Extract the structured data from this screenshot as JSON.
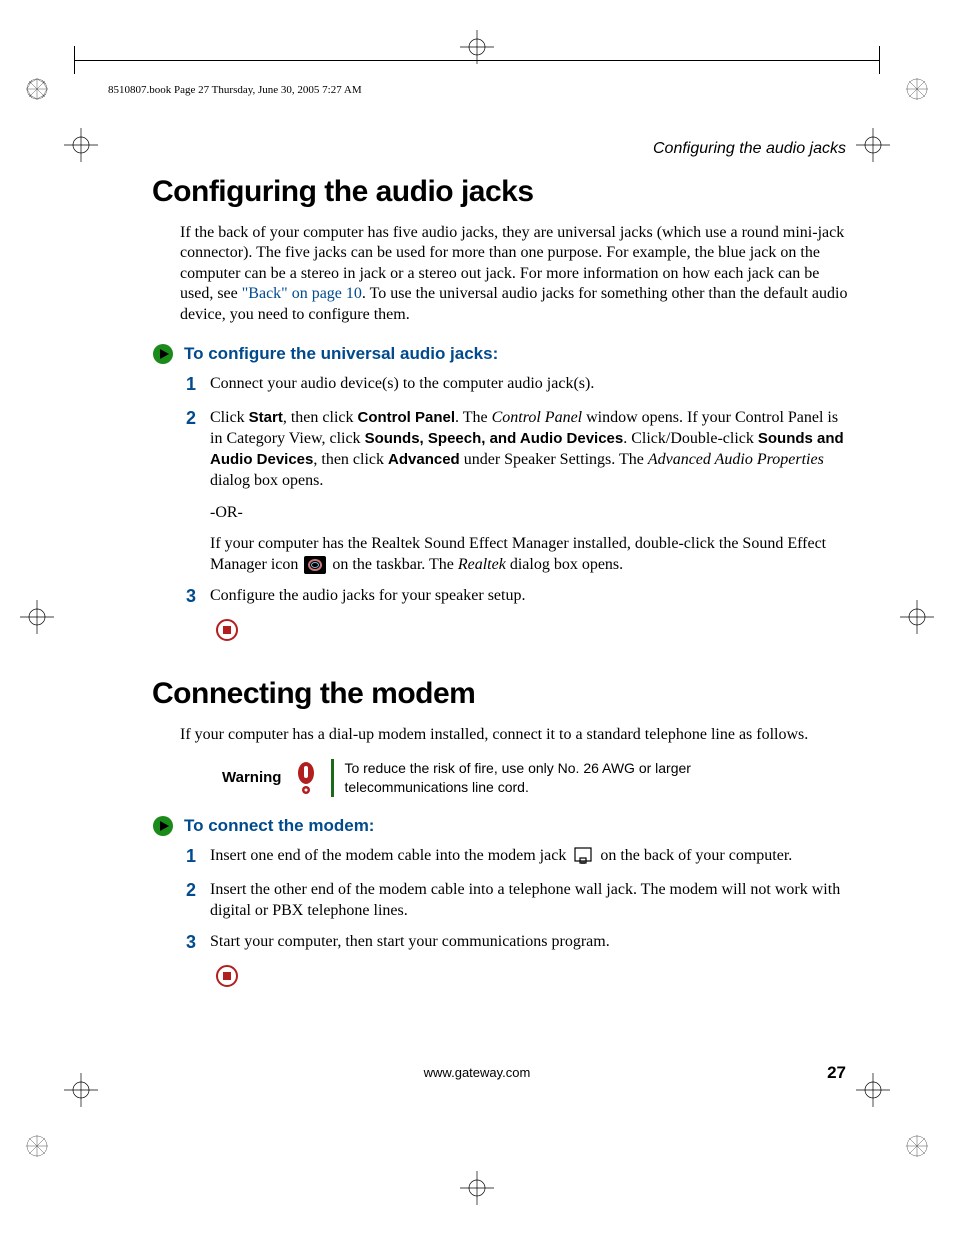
{
  "book_header": "8510807.book  Page 27  Thursday, June 30, 2005  7:27 AM",
  "running_head": "Configuring the audio jacks",
  "section1": {
    "title": "Configuring the audio jacks",
    "intro_pre": "If the back of your computer has five audio jacks, they are universal jacks (which use a round mini-jack connector). The five jacks can be used for more than one purpose. For example, the blue jack on the computer can be a stereo in jack or a stereo out jack. For more information on how each jack can be used, see ",
    "intro_link": "\"Back\" on page 10",
    "intro_post": ". To use the universal audio jacks for something other than the default audio device, you need to configure them.",
    "proc_title": "To configure the universal audio jacks:",
    "steps": {
      "s1": "Connect your audio device(s) to the computer audio jack(s).",
      "s2_a": "Click ",
      "s2_b": "Start",
      "s2_c": ", then click ",
      "s2_d": "Control Panel",
      "s2_e": ". The ",
      "s2_f": "Control Panel",
      "s2_g": " window opens. If your Control Panel is in Category View, click ",
      "s2_h": "Sounds, Speech, and Audio Devices",
      "s2_i": ". Click/Double-click ",
      "s2_j": "Sounds and Audio Devices",
      "s2_k": ", then click ",
      "s2_l": "Advanced",
      "s2_m": " under Speaker Settings. The ",
      "s2_n": "Advanced Audio Properties",
      "s2_o": " dialog box opens.",
      "s2_or": "-OR-",
      "s2_p": "If your computer has the Realtek Sound Effect Manager installed, double-click the Sound Effect Manager icon ",
      "s2_q": " on the taskbar. The ",
      "s2_r": "Realtek",
      "s2_s": " dialog box opens.",
      "s3": "Configure the audio jacks for your speaker setup."
    }
  },
  "section2": {
    "title": "Connecting the modem",
    "intro": "If your computer has a dial-up modem installed, connect it to a standard telephone line as follows.",
    "warning_label": "Warning",
    "warning_text": "To reduce the risk of fire, use only No. 26 AWG or larger telecommunications line cord.",
    "proc_title": "To connect the modem:",
    "steps": {
      "s1_a": "Insert one end of the modem cable into the modem jack ",
      "s1_b": " on the back of your computer.",
      "s2": "Insert the other end of the modem cable into a telephone wall jack. The modem will not work with digital or PBX telephone lines.",
      "s3": "Start your computer, then start your communications program."
    }
  },
  "footer_url": "www.gateway.com",
  "page_number": "27",
  "colors": {
    "link_blue": "#004a8d",
    "green": "#1a8a1a",
    "red": "#b21f1f"
  }
}
